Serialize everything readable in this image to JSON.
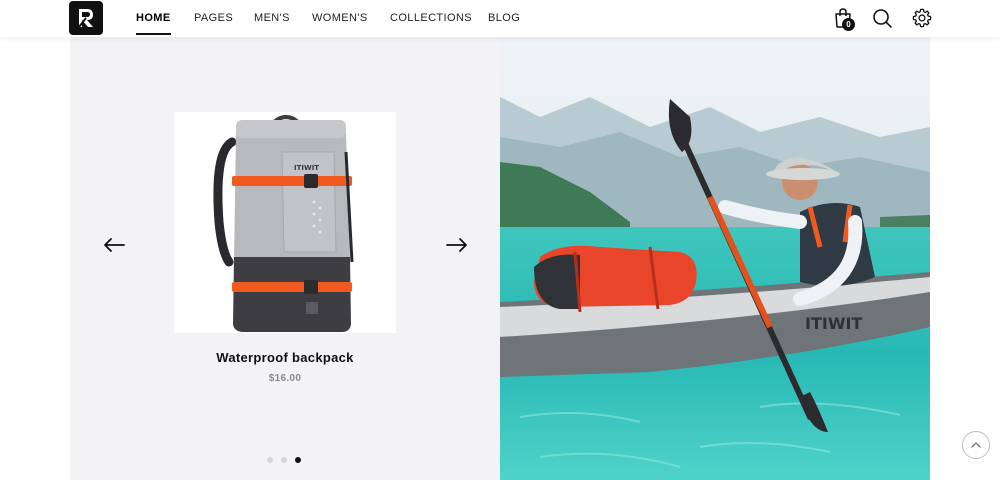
{
  "header": {
    "logo_alt": "R",
    "nav": [
      {
        "label": "HOME",
        "active": true
      },
      {
        "label": "PAGES"
      },
      {
        "label": "MEN'S"
      },
      {
        "label": "WOMEN'S"
      },
      {
        "label": "COLLECTIONS"
      },
      {
        "label": "BLOG"
      }
    ],
    "cart_count": "0",
    "icons": [
      "shopping-bag-icon",
      "search-icon",
      "gear-icon"
    ]
  },
  "slider": {
    "product_name": "Waterproof backpack",
    "product_price": "$16.00",
    "brand_on_bag": "ITIWIT",
    "dots": 3,
    "active_dot": 2
  },
  "hero": {
    "kayak_brand": "ITIWIT"
  },
  "colors": {
    "accent": "#111111",
    "orange": "#f05a1e",
    "panel_bg": "#f3f3f6",
    "water": "#3fc9c2"
  }
}
